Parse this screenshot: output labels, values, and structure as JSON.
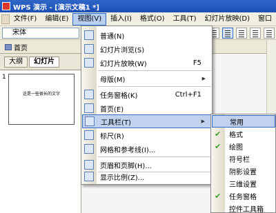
{
  "window": {
    "title": "WPS 演示 - [演示文稿1 *]"
  },
  "menubar": {
    "items": [
      {
        "label": "文件(F)"
      },
      {
        "label": "编辑(E)"
      },
      {
        "label": "视图(V)"
      },
      {
        "label": "插入(I)"
      },
      {
        "label": "格式(O)"
      },
      {
        "label": "工具(T)"
      },
      {
        "label": "幻灯片放映(D)"
      },
      {
        "label": "窗口"
      }
    ]
  },
  "toolbar": {
    "font": "宋体"
  },
  "tabs": {
    "home": "首页"
  },
  "left_panel": {
    "tabs": [
      {
        "label": "大纲"
      },
      {
        "label": "幻灯片"
      }
    ],
    "slide_number": "1",
    "slide_text": "这是一些很长的文字"
  },
  "view_menu": {
    "items": [
      {
        "label": "普通(N)",
        "icon": "normal-view-icon"
      },
      {
        "label": "幻灯片浏览(S)",
        "icon": "slide-sorter-icon"
      },
      {
        "label": "幻灯片放映(W)",
        "icon": "slideshow-icon",
        "shortcut": "F5"
      },
      {
        "label": "母版(M)",
        "arrow": "▶"
      },
      {
        "label": "任务窗格(K)",
        "icon": "task-pane-icon",
        "shortcut": "Ctrl+F1"
      },
      {
        "label": "首页(E)",
        "icon": "home-icon"
      },
      {
        "label": "工具栏(T)",
        "icon": "toolbar-icon",
        "arrow": "▶"
      },
      {
        "label": "标尺(R)",
        "icon": "ruler-icon"
      },
      {
        "label": "网格和参考线(I)...",
        "icon": "grid-icon"
      },
      {
        "label": "页眉和页脚(H)...",
        "icon": "header-footer-icon"
      },
      {
        "label": "显示比例(Z)...",
        "icon": "zoom-icon"
      }
    ]
  },
  "toolbar_submenu": {
    "items": [
      {
        "label": "常用",
        "checked": false
      },
      {
        "label": "格式",
        "checked": true
      },
      {
        "label": "绘图",
        "checked": true
      },
      {
        "label": "符号栏",
        "checked": false
      },
      {
        "label": "阴影设置",
        "checked": false
      },
      {
        "label": "三维设置",
        "checked": false
      },
      {
        "label": "任务窗格",
        "checked": true
      },
      {
        "label": "控件工具箱",
        "checked": false
      }
    ],
    "check_mark": "✔"
  },
  "colors": {
    "title_bar": "#1b4fb3",
    "highlight": "#c1d2ee",
    "check": "#3a9a2a"
  }
}
